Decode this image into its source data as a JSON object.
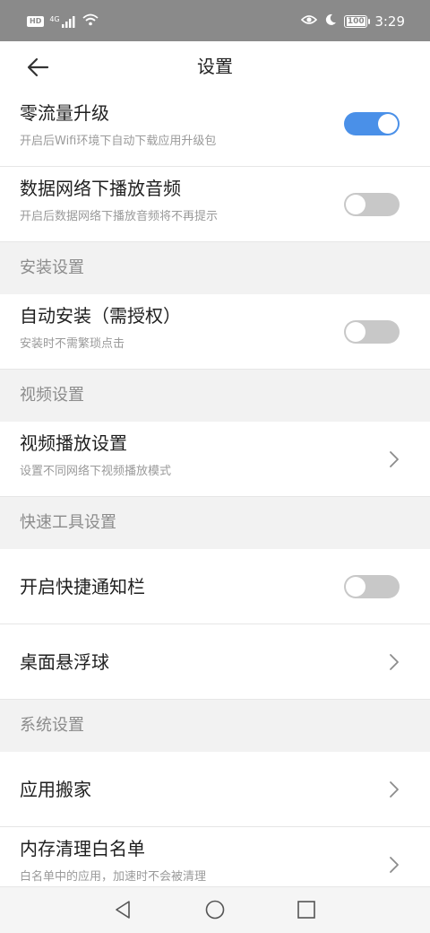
{
  "status_bar": {
    "hd_badge": "HD",
    "network": "4G",
    "time": "3:29",
    "battery": "100",
    "icons": [
      "signal-icon",
      "wifi-icon",
      "eye-icon",
      "moon-icon",
      "battery-icon"
    ]
  },
  "header": {
    "title": "设置",
    "back_icon": "arrow-left-icon"
  },
  "rows": {
    "zero_traffic": {
      "title": "零流量升级",
      "subtitle": "开启后Wifi环境下自动下载应用升级包",
      "toggle": "on"
    },
    "data_audio": {
      "title": "数据网络下播放音频",
      "subtitle": "开启后数据网络下播放音频将不再提示",
      "toggle": "off"
    },
    "auto_install": {
      "title": "自动安装（需授权）",
      "subtitle": "安装时不需繁琐点击",
      "toggle": "off"
    },
    "video_play": {
      "title": "视频播放设置",
      "subtitle": "设置不同网络下视频播放模式"
    },
    "quick_notify": {
      "title": "开启快捷通知栏",
      "toggle": "off"
    },
    "float_ball": {
      "title": "桌面悬浮球"
    },
    "app_move": {
      "title": "应用搬家"
    },
    "whitelist": {
      "title": "内存清理白名单",
      "subtitle": "白名单中的应用，加速时不会被清理"
    }
  },
  "sections": {
    "install": "安装设置",
    "video": "视频设置",
    "quick_tools": "快速工具设置",
    "system": "系统设置"
  },
  "colors": {
    "accent": "#4a90e8",
    "toggle_off": "#c8c8c8",
    "section_bg": "#f2f2f2",
    "status_bar": "#8a8a8a"
  },
  "navbar": {
    "icons": [
      "back-triangle-icon",
      "home-circle-icon",
      "recents-square-icon"
    ]
  }
}
